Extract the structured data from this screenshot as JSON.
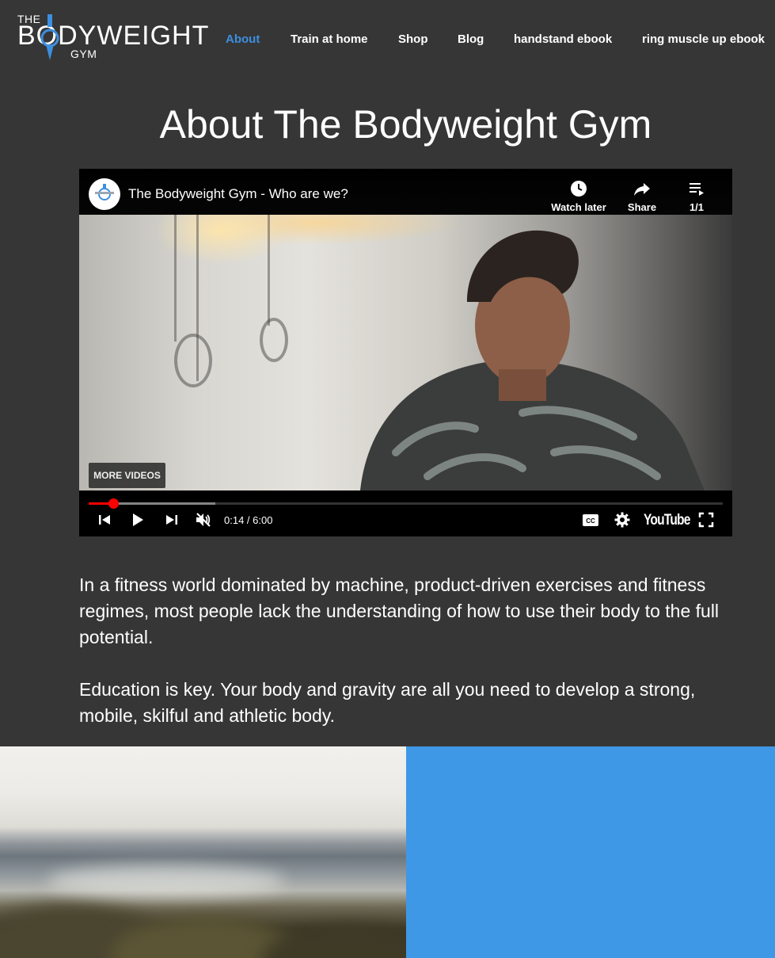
{
  "site": {
    "logo": {
      "the": "THE",
      "main": "BODYWEIGHT",
      "gym": "GYM"
    },
    "nav": [
      {
        "label": "About",
        "active": true
      },
      {
        "label": "Train at home",
        "active": false
      },
      {
        "label": "Shop",
        "active": false
      },
      {
        "label": "Blog",
        "active": false
      },
      {
        "label": "handstand ebook",
        "active": false
      },
      {
        "label": "ring muscle up ebook",
        "active": false
      }
    ]
  },
  "page": {
    "title": "About The Bodyweight Gym"
  },
  "video": {
    "title": "The Bodyweight Gym - Who are we?",
    "channel_icon": "bodyweight-gym-logo",
    "actions": {
      "watch_later": "Watch later",
      "share": "Share",
      "playlist": "1/1"
    },
    "more_videos": "MORE VIDEOS",
    "time": "0:14 / 6:00",
    "youtube": "YouTube",
    "progress": 0.039,
    "buffered": 0.2,
    "muted": true
  },
  "content": {
    "paragraph1": "In a fitness world dominated by machine, product-driven exercises and fitness regimes, most people lack the understanding of how to use their body to the full potential.",
    "paragraph2": "Education is key. Your body and gravity are all you need to develop a strong, mobile, skilful and athletic body."
  },
  "colors": {
    "background": "#363636",
    "accent": "#3d8fe0",
    "panel_blue": "#3f98e6",
    "progress_red": "#ff0000"
  }
}
